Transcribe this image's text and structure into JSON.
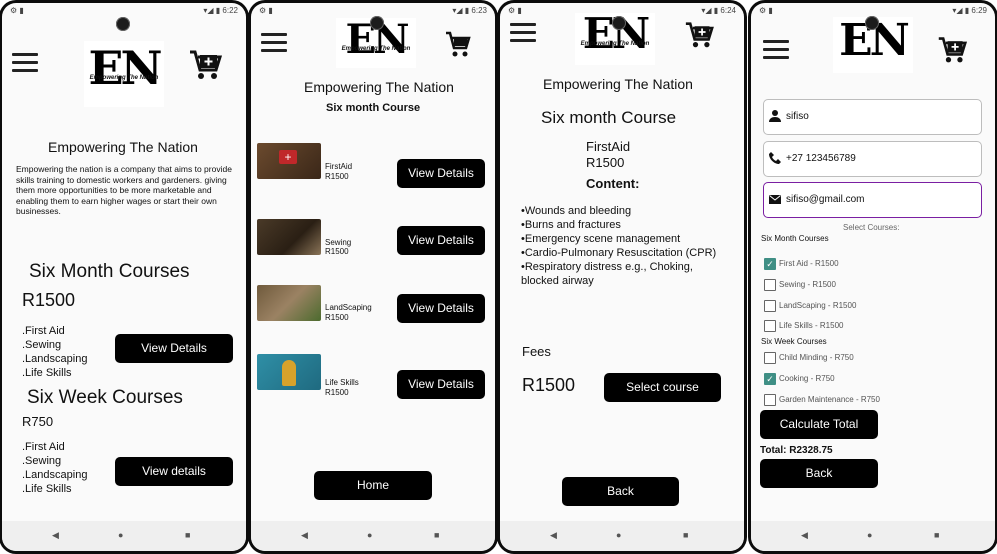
{
  "screens": [
    {
      "status": {
        "left": "⚙ ▮",
        "right": "▾◢ ▮ 6:22"
      },
      "brand": "Empowering The Nation",
      "logo": {
        "initials": "EN",
        "tagline": "Empowering The Nation"
      },
      "description": "Empowering the nation is a company that aims to provide skills training to domestic workers and gardeners. giving them more opportunities to be more marketable and enabling them to earn higher wages or start their own businesses.",
      "six_month": {
        "title": "Six Month Courses",
        "price": "R1500",
        "items": [
          ".First Aid",
          ".Sewing",
          ".Landscaping",
          ".Life Skills"
        ],
        "button": "View Details"
      },
      "six_week": {
        "title": "Six Week Courses",
        "price": "R750",
        "items": [
          ".First Aid",
          ".Sewing",
          ".Landscaping",
          ".Life Skills"
        ],
        "button": "View details"
      }
    },
    {
      "status": {
        "left": "⚙ ▮",
        "right": "▾◢ ▮ 6:23"
      },
      "brand": "Empowering The Nation",
      "logo": {
        "initials": "EN",
        "tagline": "Empowering The Nation"
      },
      "subtitle": "Six month Course",
      "courses": [
        {
          "name": "FirstAid",
          "price": "R1500",
          "button": "View Details"
        },
        {
          "name": "Sewing",
          "price": "R1500",
          "button": "View Details"
        },
        {
          "name": "LandScaping",
          "price": "R1500",
          "button": "View Details"
        },
        {
          "name": "Life Skills",
          "price": "R1500",
          "button": "View Details"
        }
      ],
      "home_button": "Home"
    },
    {
      "status": {
        "left": "⚙ ▮",
        "right": "▾◢ ▮ 6:24"
      },
      "brand": "Empowering The Nation",
      "logo": {
        "initials": "EN",
        "tagline": "Empowering The Nation"
      },
      "title": "Six month Course",
      "course": "FirstAid",
      "price": "R1500",
      "content_label": "Content:",
      "content": [
        "•Wounds and bleeding",
        "•Burns and fractures",
        "•Emergency scene management",
        "•Cardio-Pulmonary Resuscitation (CPR)",
        "•Respiratory distress e.g., Choking,",
        "blocked airway"
      ],
      "fees_label": "Fees",
      "fees": "R1500",
      "select_button": "Select course",
      "back_button": "Back"
    },
    {
      "status": {
        "left": "⚙ ▮",
        "right": "▾◢ ▮ 6:29"
      },
      "logo": {
        "initials": "EN",
        "tagline": "Empowering The Nation"
      },
      "name": "sifiso",
      "phone": "+27 123456789",
      "email": "sifiso@gmail.com",
      "select_label": "Select Courses:",
      "six_month_label": "Six Month Courses",
      "six_month_options": [
        {
          "label": "First Aid - R1500",
          "checked": true
        },
        {
          "label": "Sewing - R1500",
          "checked": false
        },
        {
          "label": "LandScaping - R1500",
          "checked": false
        },
        {
          "label": "Life Skills - R1500",
          "checked": false
        }
      ],
      "six_week_label": "Six Week Courses",
      "six_week_options": [
        {
          "label": "Child Minding - R750",
          "checked": false
        },
        {
          "label": "Cooking - R750",
          "checked": true
        },
        {
          "label": "Garden Maintenance - R750",
          "checked": false
        }
      ],
      "calc_button": "Calculate Total",
      "total": "Total: R2328.75",
      "back_button": "Back"
    }
  ],
  "nav": {
    "back": "◀",
    "home": "●",
    "recents": "■"
  },
  "colors": {
    "button": "#000000",
    "checkbox": "#3f8f85",
    "active_field": "#7a1fa2"
  }
}
